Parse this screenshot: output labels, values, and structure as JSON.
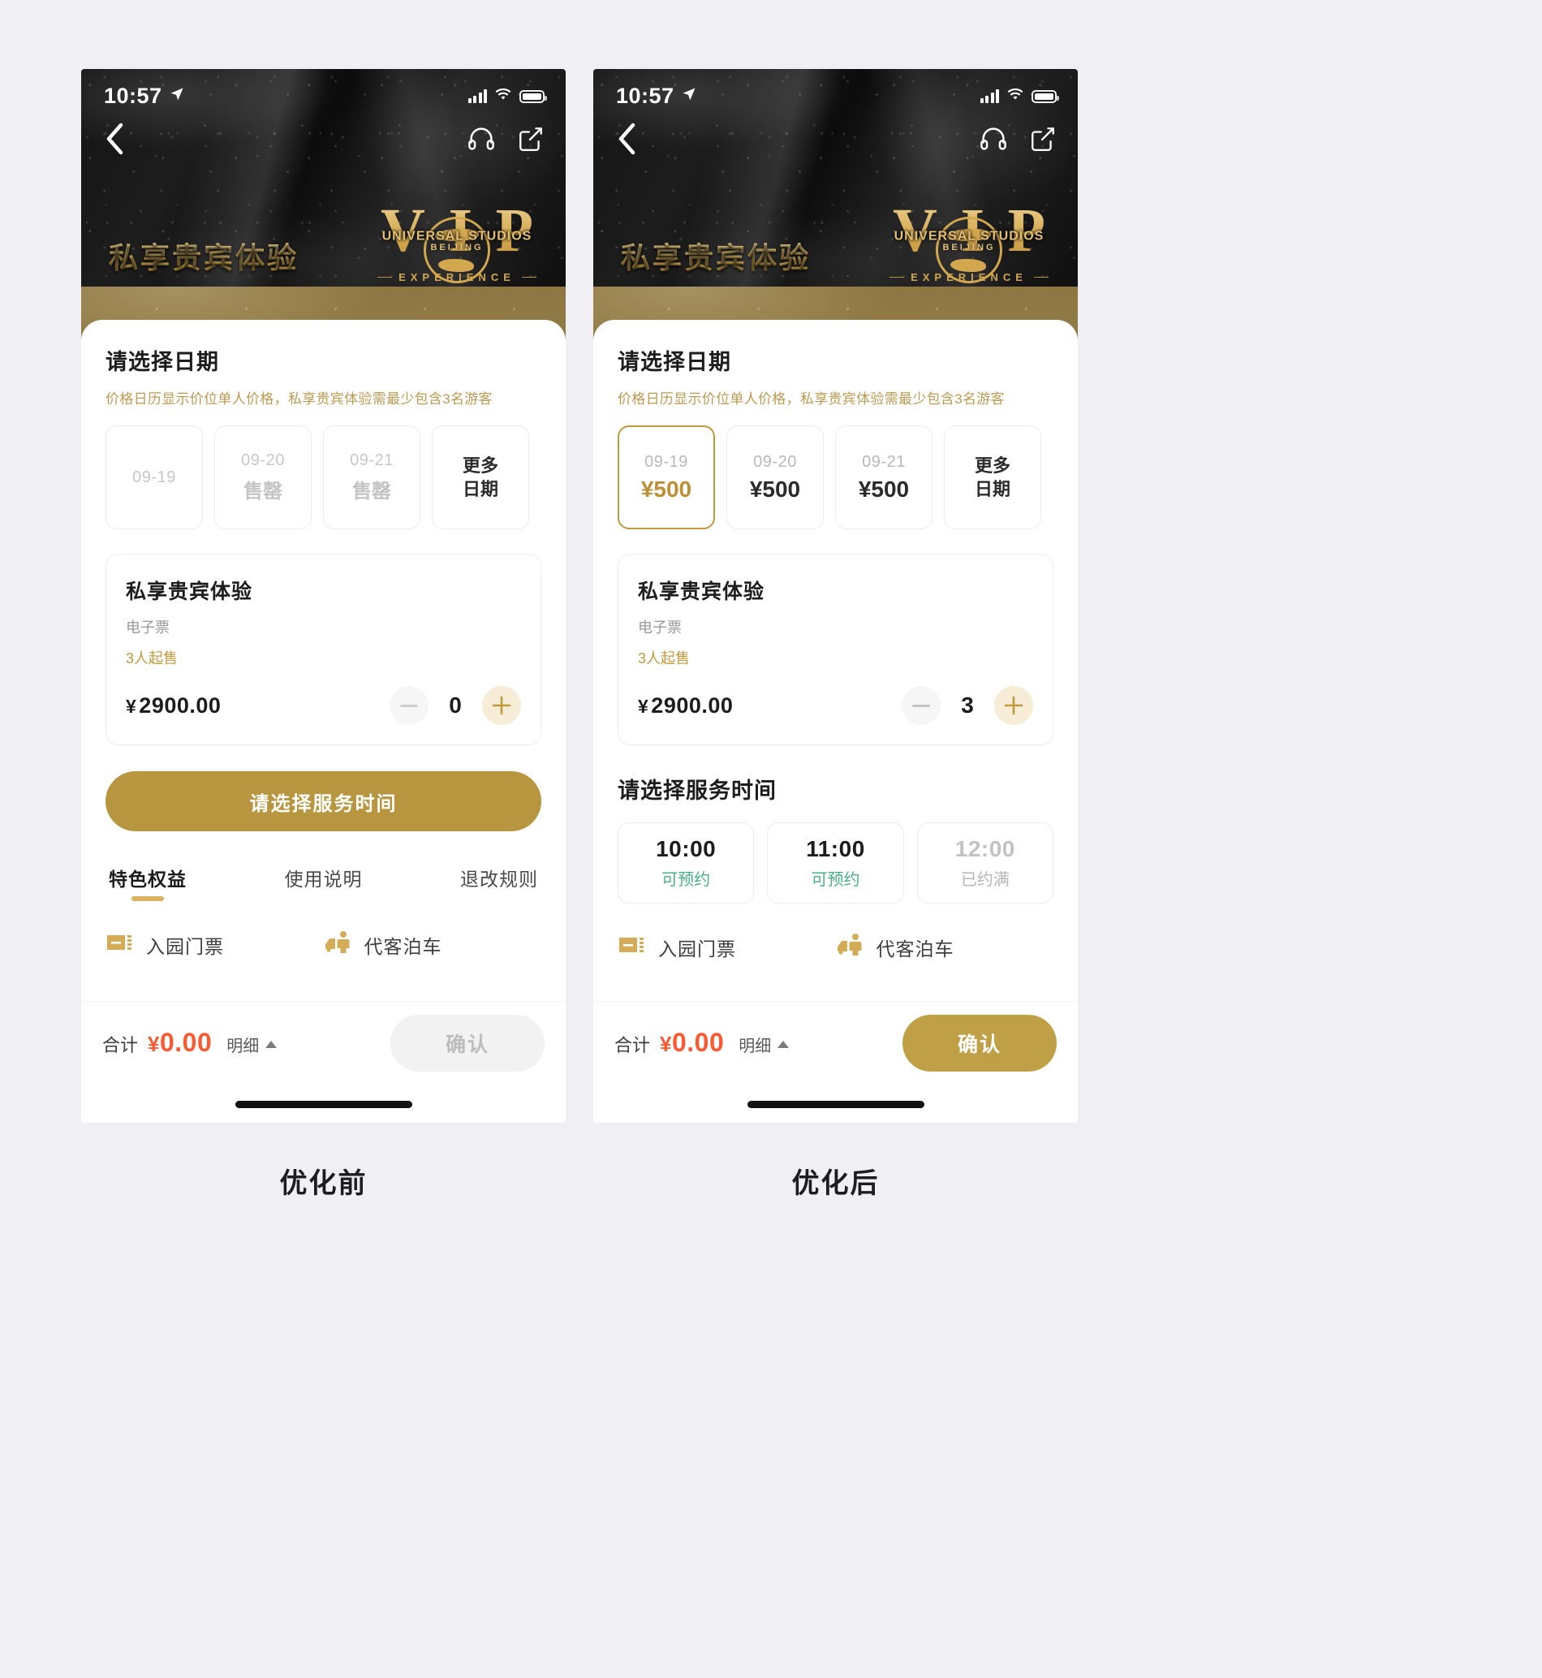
{
  "captions": {
    "before": "优化前",
    "after": "优化后"
  },
  "status_bar": {
    "time": "10:57",
    "location_icon": "location-arrow-icon",
    "signal_icon": "cellular-signal-icon",
    "wifi_icon": "wifi-icon",
    "battery_icon": "battery-icon"
  },
  "nav": {
    "back_icon": "chevron-left-icon",
    "support_icon": "headset-icon",
    "share_icon": "share-icon"
  },
  "hero": {
    "title": "私享贵宾体验",
    "logo": {
      "letters": [
        "V",
        "I",
        "P"
      ],
      "studio": "UNIVERSAL STUDIOS",
      "city": "BEIJING",
      "tagline": "EXPERIENCE"
    }
  },
  "date_section": {
    "title": "请选择日期",
    "subtitle": "价格日历显示价位单人价格，私享贵宾体验需最少包含3名游客",
    "more_label_line1": "更多",
    "more_label_line2": "日期",
    "before": [
      {
        "date": "09-19",
        "status": "",
        "price": "",
        "state": "empty"
      },
      {
        "date": "09-20",
        "status": "售罄",
        "price": "",
        "state": "soldout"
      },
      {
        "date": "09-21",
        "status": "售罄",
        "price": "",
        "state": "soldout"
      }
    ],
    "after": [
      {
        "date": "09-19",
        "status": "",
        "price": "¥500",
        "state": "selected"
      },
      {
        "date": "09-20",
        "status": "",
        "price": "¥500",
        "state": "available"
      },
      {
        "date": "09-21",
        "status": "",
        "price": "¥500",
        "state": "available"
      }
    ]
  },
  "product": {
    "name": "私享贵宾体验",
    "ticket_type": "电子票",
    "min_note": "3人起售",
    "currency": "¥",
    "price": "2900.00",
    "qty_before": "0",
    "qty_after": "3",
    "minus_icon": "minus-icon",
    "plus_icon": "plus-icon"
  },
  "cta": {
    "label": "请选择服务时间"
  },
  "time_section": {
    "title": "请选择服务时间",
    "slots": [
      {
        "time": "10:00",
        "status": "可预约",
        "state": "available"
      },
      {
        "time": "11:00",
        "status": "可预约",
        "state": "available"
      },
      {
        "time": "12:00",
        "status": "已约满",
        "state": "full"
      }
    ]
  },
  "tabs": [
    {
      "label": "特色权益",
      "active": true
    },
    {
      "label": "使用说明",
      "active": false
    },
    {
      "label": "退改规则",
      "active": false
    }
  ],
  "benefits": [
    {
      "label": "入园门票",
      "icon": "ticket-icon"
    },
    {
      "label": "代客泊车",
      "icon": "valet-parking-icon"
    }
  ],
  "bottom_bar": {
    "total_label": "合计",
    "currency": "¥",
    "total_amount": "0.00",
    "detail_label": "明细",
    "detail_caret_icon": "caret-up-icon",
    "confirm_label": "确认"
  },
  "colors": {
    "gold": "#b8963f",
    "gold_light": "#d9b25f",
    "gold_text": "#c09a3e",
    "price_red": "#fa5a32",
    "green": "#4caf85",
    "page_bg": "#f0f0f4"
  }
}
